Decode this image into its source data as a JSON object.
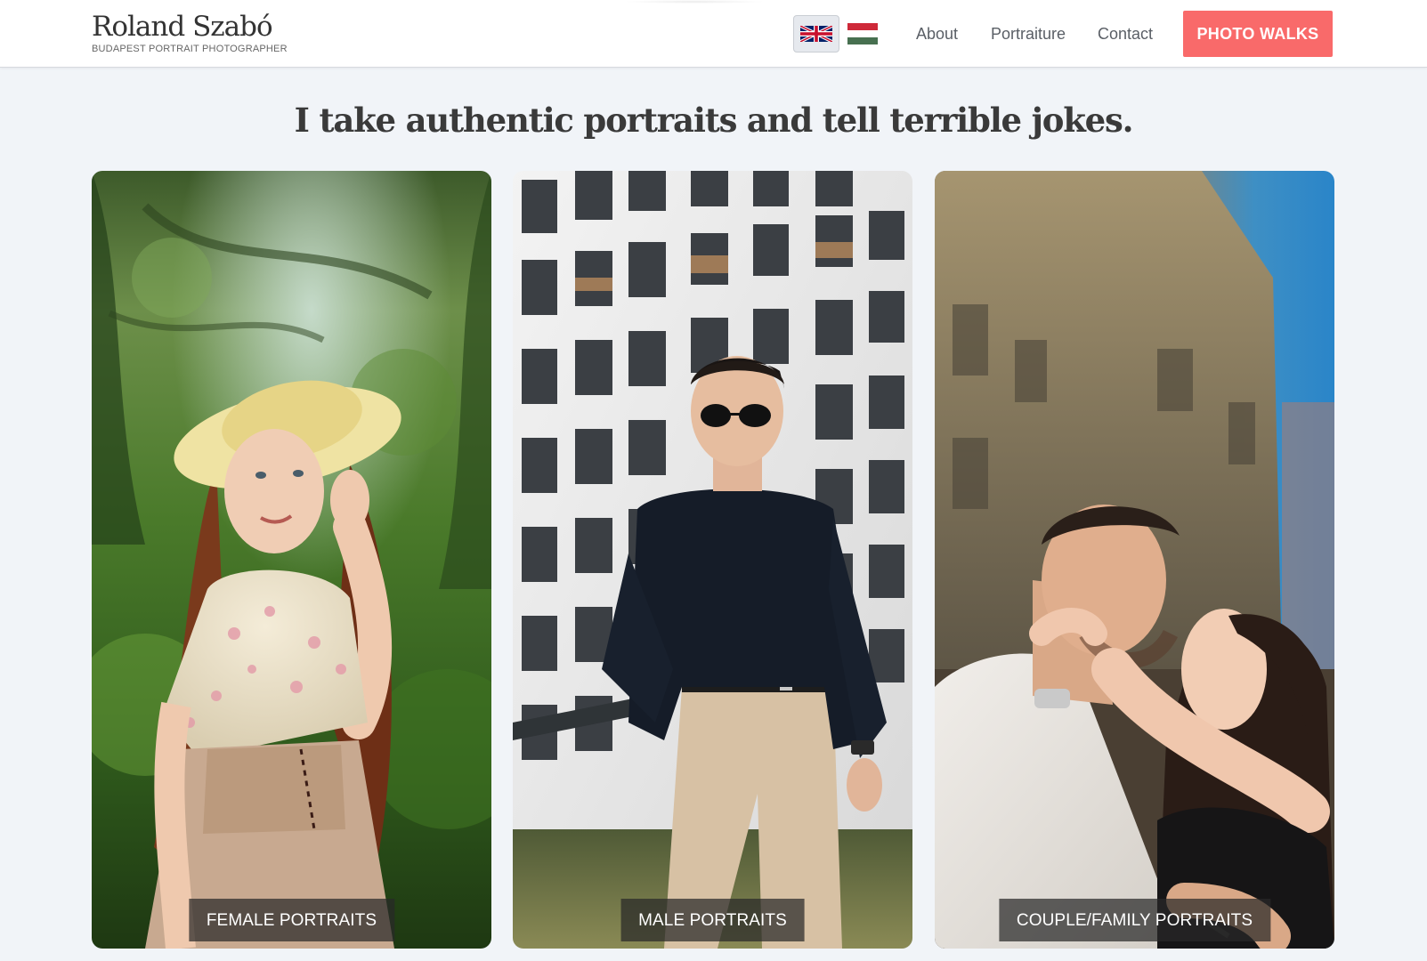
{
  "header": {
    "brand_name": "Roland Szabó",
    "brand_tagline": "BUDAPEST PORTRAIT PHOTOGRAPHER",
    "languages": [
      {
        "code": "en",
        "icon": "uk-flag-icon",
        "active": true
      },
      {
        "code": "hu",
        "icon": "hungary-flag-icon",
        "active": false
      }
    ],
    "nav": {
      "about": "About",
      "portraiture": "Portraiture",
      "contact": "Contact"
    },
    "cta_label": "PHOTO WALKS"
  },
  "headline": "I take authentic portraits and tell terrible jokes.",
  "cards": [
    {
      "label": "FEMALE PORTRAITS"
    },
    {
      "label": "MALE PORTRAITS"
    },
    {
      "label": "COUPLE/FAMILY PORTRAITS"
    }
  ],
  "colors": {
    "page_background": "#f1f4f8",
    "header_background": "#ffffff",
    "cta_background": "#f96a6a",
    "cta_text": "#ffffff",
    "nav_text": "#5a5f66",
    "label_background": "rgba(40,40,40,0.72)"
  }
}
